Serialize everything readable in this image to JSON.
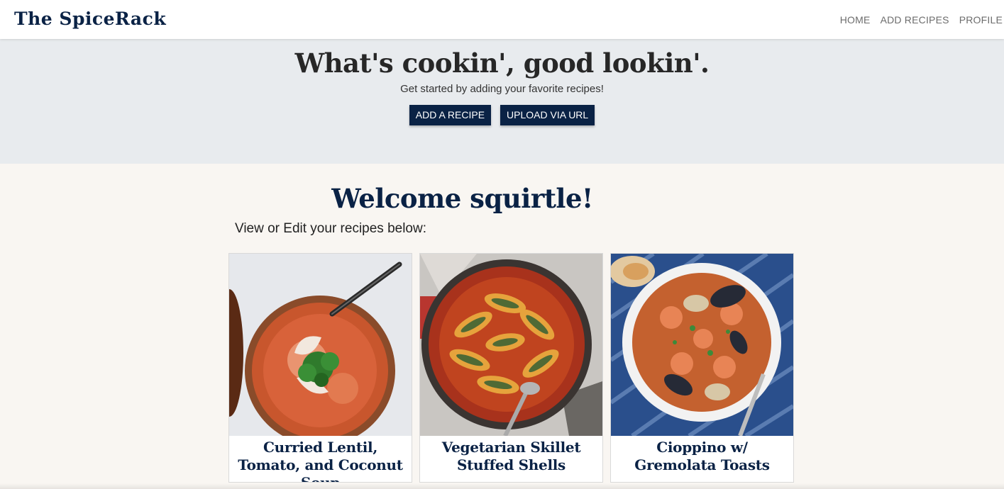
{
  "navbar": {
    "brand": "The SpiceRack",
    "links": [
      "HOME",
      "ADD RECIPES",
      "PROFILE"
    ]
  },
  "hero": {
    "title": "What's cookin', good lookin'.",
    "subtitle": "Get started by adding your favorite recipes!",
    "buttons": [
      "ADD A RECIPE",
      "UPLOAD VIA URL"
    ]
  },
  "main": {
    "welcome": "Welcome squirtle!",
    "subtitle": "View or Edit your recipes below:",
    "recipes": [
      {
        "title": "Curried Lentil, Tomato, and Coconut Soup",
        "image": "soup-bowl-photo"
      },
      {
        "title": "Vegetarian Skillet Stuffed Shells",
        "image": "stuffed-shells-skillet-photo"
      },
      {
        "title": "Cioppino w/ Gremolata Toasts",
        "image": "cioppino-bowl-photo"
      }
    ]
  },
  "colors": {
    "brand_navy": "#0a2245",
    "hero_bg": "#e8ebee",
    "page_bg": "#f9f6f2"
  }
}
